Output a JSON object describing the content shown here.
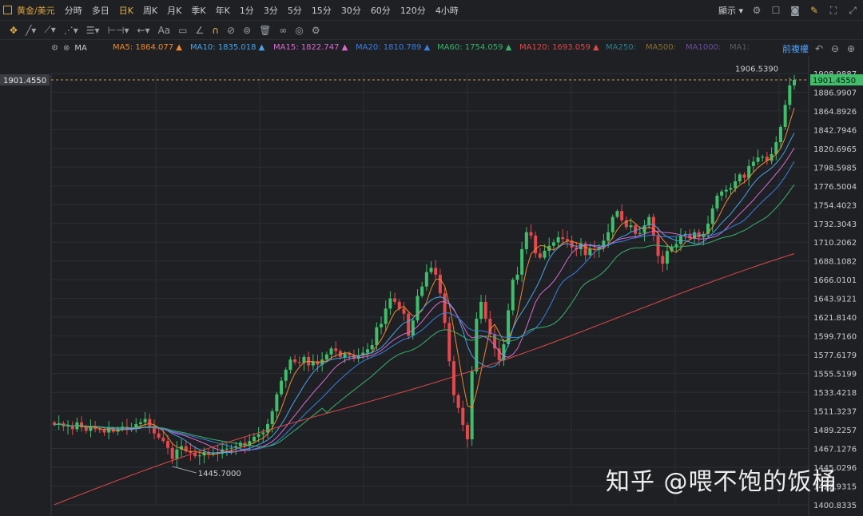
{
  "topbar": {
    "symbol": "黄金/美元",
    "periods": [
      "分時",
      "多日",
      "日K",
      "周K",
      "月K",
      "季K",
      "年K",
      "1分",
      "3分",
      "5分",
      "15分",
      "30分",
      "60分",
      "120分",
      "4小時"
    ],
    "active_period": "日K",
    "display_label": "顯示"
  },
  "mabar": {
    "indicator": "MA",
    "items": [
      {
        "label": "MA5: 1864.077 ▲",
        "color": "#f0892b"
      },
      {
        "label": "MA10: 1835.018 ▲",
        "color": "#4aa3e8"
      },
      {
        "label": "MA15: 1822.747 ▲",
        "color": "#d86bd3"
      },
      {
        "label": "MA20: 1810.789 ▲",
        "color": "#3b7fe0"
      },
      {
        "label": "MA60: 1754.059 ▲",
        "color": "#38b36b"
      },
      {
        "label": "MA120: 1693.059 ▲",
        "color": "#e04848"
      },
      {
        "label": "MA250:",
        "color": "#2a7f8a"
      },
      {
        "label": "MA500:",
        "color": "#8a6d2e"
      },
      {
        "label": "MA1000:",
        "color": "#6a4f9a"
      },
      {
        "label": "MA1:",
        "color": "#5a5e66"
      }
    ],
    "restore_label": "前複權"
  },
  "colors": {
    "up": "#3fbf6a",
    "down": "#e5484d",
    "grid": "#2b2e33",
    "bg": "#1e2024"
  },
  "chart_data": {
    "type": "candlestick",
    "ylim": [
      1400.8335,
      1908.9887
    ],
    "y_ticks": [
      "1908.9887",
      "1886.9907",
      "1864.8926",
      "1842.7946",
      "1820.6965",
      "1798.5985",
      "1776.5004",
      "1754.4023",
      "1732.3043",
      "1710.2062",
      "1688.1082",
      "1666.0101",
      "1643.9121",
      "1621.8140",
      "1599.7160",
      "1577.6179",
      "1555.5199",
      "1533.4218",
      "1511.3237",
      "1489.2257",
      "1467.1276",
      "1445.0296",
      "1422.9315",
      "1400.8335"
    ],
    "last_price": "1901.4550",
    "high_label": "1906.5390",
    "low_label": "1445.7000",
    "closes": [
      1495,
      1497,
      1493,
      1494,
      1490,
      1498,
      1492,
      1488,
      1494,
      1490,
      1489,
      1486,
      1491,
      1487,
      1490,
      1493,
      1489,
      1492,
      1496,
      1498,
      1502,
      1494,
      1485,
      1480,
      1476,
      1468,
      1455,
      1466,
      1470,
      1464,
      1462,
      1458,
      1459,
      1463,
      1460,
      1462,
      1461,
      1466,
      1467,
      1468,
      1470,
      1474,
      1470,
      1476,
      1481,
      1484,
      1486,
      1496,
      1511,
      1531,
      1547,
      1560,
      1572,
      1569,
      1568,
      1575,
      1565,
      1570,
      1566,
      1572,
      1578,
      1585,
      1582,
      1575,
      1579,
      1577,
      1573,
      1577,
      1580,
      1584,
      1589,
      1610,
      1614,
      1632,
      1644,
      1640,
      1632,
      1626,
      1600,
      1618,
      1647,
      1658,
      1675,
      1680,
      1672,
      1650,
      1615,
      1570,
      1530,
      1515,
      1495,
      1478,
      1558,
      1620,
      1640,
      1620,
      1602,
      1585,
      1571,
      1590,
      1630,
      1666,
      1672,
      1702,
      1722,
      1718,
      1697,
      1692,
      1700,
      1706,
      1710,
      1716,
      1714,
      1712,
      1704,
      1702,
      1709,
      1695,
      1702,
      1701,
      1704,
      1712,
      1722,
      1740,
      1747,
      1736,
      1728,
      1730,
      1720,
      1721,
      1730,
      1740,
      1718,
      1694,
      1685,
      1700,
      1705,
      1708,
      1718,
      1720,
      1715,
      1722,
      1716,
      1720,
      1732,
      1750,
      1765,
      1770,
      1772,
      1774,
      1782,
      1790,
      1786,
      1800,
      1805,
      1810,
      1811,
      1806,
      1814,
      1828,
      1846,
      1872,
      1895,
      1901.455
    ]
  }
}
